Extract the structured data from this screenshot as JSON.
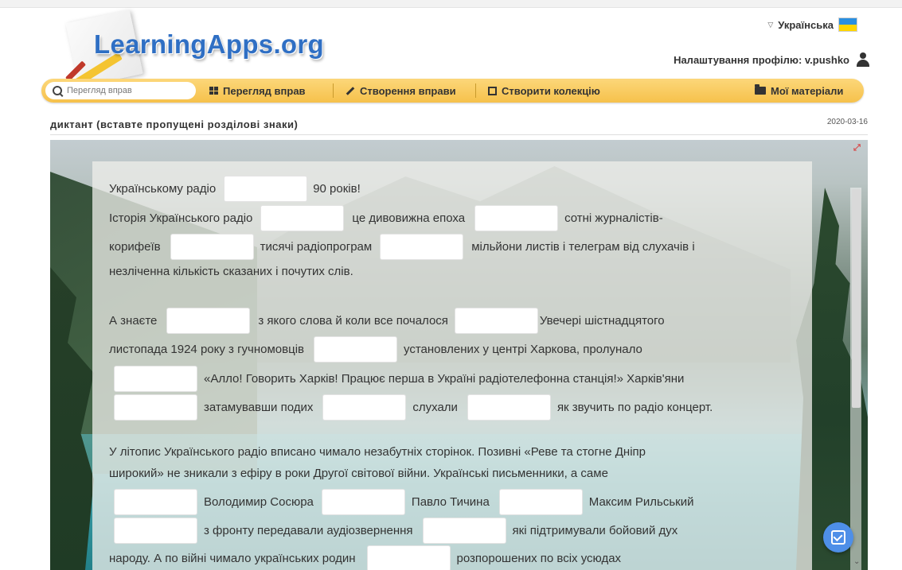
{
  "header": {
    "logo_text": "LearningApps.org",
    "language": "Українська",
    "profile_label": "Налаштування профілю: v.pushko"
  },
  "nav": {
    "search_placeholder": "Перегляд вправ",
    "browse": "Перегляд вправ",
    "create": "Створення вправи",
    "collection": "Створити колекцію",
    "my_materials": "Мої матеріали"
  },
  "exercise": {
    "title": "диктант (вставте пропущені розділові знаки)",
    "date": "2020-03-16"
  },
  "text": {
    "p1": {
      "l1": [
        "Українському радіо",
        "90 років!"
      ],
      "l2": [
        "Історія Українського радіо",
        "це дивовижна епоха",
        "сотні журналістів-"
      ],
      "l3": [
        "корифеїв",
        "тисячі радіопрограм",
        "мільйони листів і телеграм від слухачів і"
      ],
      "l4": [
        "незліченна кількість сказаних і почутих слів."
      ]
    },
    "p2": {
      "l1": [
        "А знаєте",
        "з якого слова й коли все почалося",
        "Увечері шістнадцятого"
      ],
      "l2": [
        "листопада 1924 року з гучномовців",
        "установлених у центрі Харкова, пролунало"
      ],
      "l3": [
        "«Алло! Говорить Харків! Працює перша в Україні радіотелефонна станція!» Харків'яни"
      ],
      "l4": [
        "затамувавши подих",
        "слухали",
        "як звучить по радіо концерт."
      ]
    },
    "p3": {
      "l1": [
        "У літопис Українського радіо вписано чимало незабутніх сторінок. Позивні «Реве та стогне Дніпр"
      ],
      "l2": [
        "широкий» не зникали з ефіру в роки Другої світової війни. Українські письменники, а саме"
      ],
      "l3": [
        "Володимир Сосюра",
        "Павло Тичина",
        "Максим Рильський"
      ],
      "l4": [
        "з фронту передавали аудіозвернення",
        "які підтримували бойовий дух"
      ],
      "l5": [
        "народу. А по війні чимало українських родин",
        "розпорошених по всіх усюдах"
      ]
    }
  },
  "colors": {
    "navbar": "#f6c14b",
    "logo": "#2f6fc4",
    "check_button": "#4e8fe8"
  }
}
